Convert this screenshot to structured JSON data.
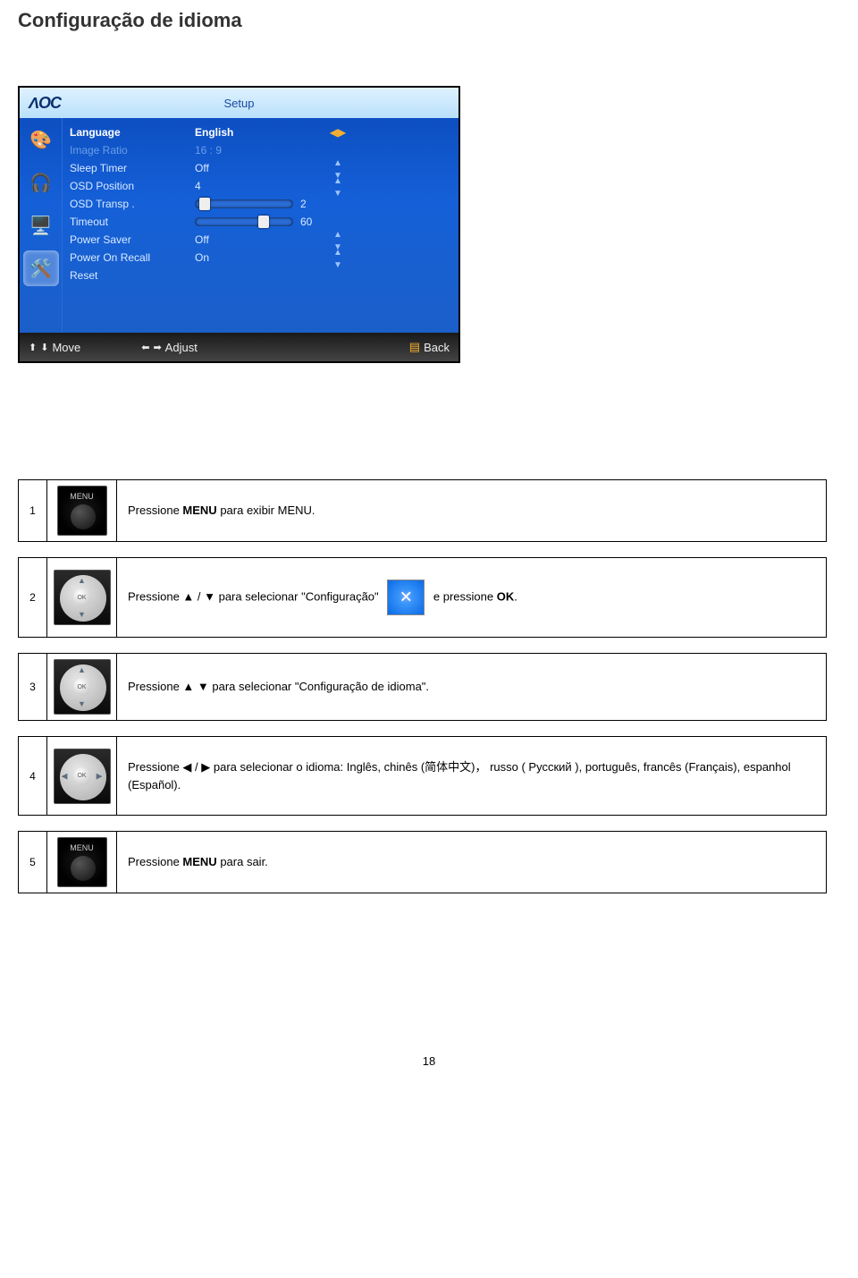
{
  "heading": "Configuração de idioma",
  "osd": {
    "logo": "ΛOC",
    "tab": "Setup",
    "items": [
      {
        "label": "Language",
        "value": "English",
        "style": "hl",
        "indicator": "lr"
      },
      {
        "label": "Image Ratio",
        "value": "16 : 9",
        "style": "dim",
        "indicator": ""
      },
      {
        "label": "Sleep Timer",
        "value": "Off",
        "style": "",
        "indicator": "ud"
      },
      {
        "label": "OSD Position",
        "value": "4",
        "style": "",
        "indicator": "ud"
      },
      {
        "label": "OSD Transp .",
        "value": "slider:10:2",
        "style": "",
        "indicator": ""
      },
      {
        "label": "Timeout",
        "value": "slider:70:60",
        "style": "",
        "indicator": ""
      },
      {
        "label": "Power Saver",
        "value": "Off",
        "style": "",
        "indicator": "ud"
      },
      {
        "label": "Power On Recall",
        "value": "On",
        "style": "",
        "indicator": "ud"
      },
      {
        "label": "Reset",
        "value": "",
        "style": "",
        "indicator": ""
      }
    ],
    "footer": {
      "move": "Move",
      "adjust": "Adjust",
      "back": "Back"
    }
  },
  "steps": {
    "s1": {
      "num": "1",
      "pre": "Pressione ",
      "bold": "MENU",
      "post": " para exibir MENU."
    },
    "s2": {
      "num": "2",
      "pre": "Pressione   ▲ / ▼   para selecionar \"Configuração\"   ",
      "mid": "   e pressione ",
      "bold": "OK",
      "post": "."
    },
    "s3": {
      "num": "3",
      "text": "Pressione   ▲   ▼   para selecionar \"Configuração de idioma\"."
    },
    "s4": {
      "num": "4",
      "text": "Pressione  ◀ / ▶  para selecionar o idioma: Inglês, chinês (简体中文)， russo ( Русский ), português, francês (Français), espanhol (Español)."
    },
    "s5": {
      "num": "5",
      "pre": "Pressione ",
      "bold": "MENU",
      "post": " para sair."
    }
  },
  "page_number": "18"
}
